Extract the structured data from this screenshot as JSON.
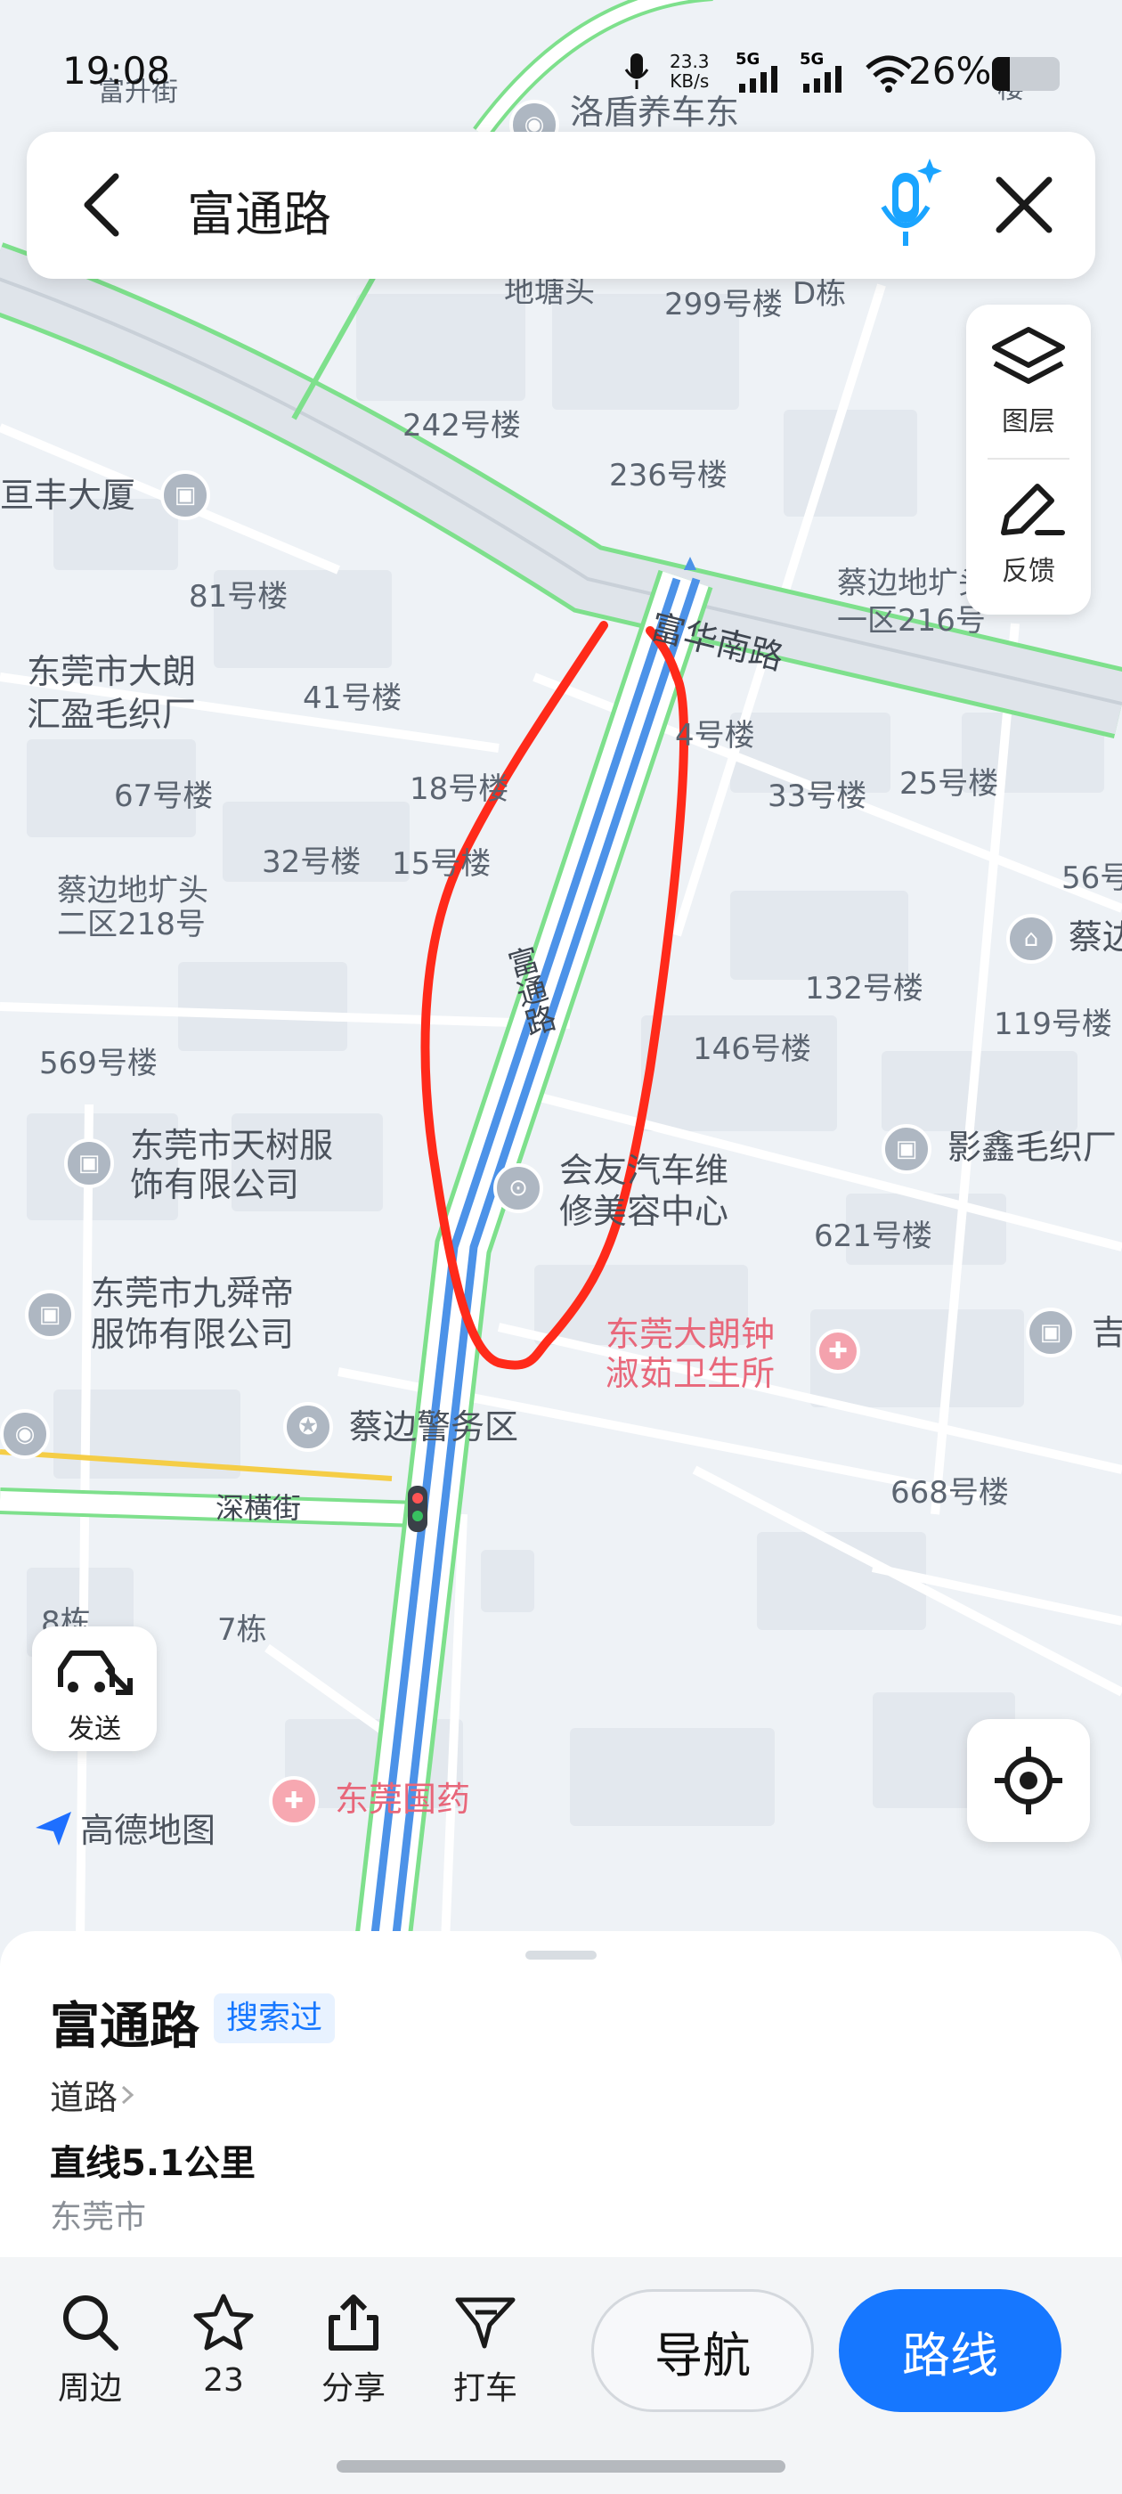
{
  "status_bar": {
    "time": "19:08",
    "net_speed_top": "23.3",
    "net_speed_unit": "KB/s",
    "sig1": "5G",
    "sig2": "5G",
    "battery": "26%"
  },
  "search": {
    "query": "富通路"
  },
  "map": {
    "labels": {
      "luodun": "洛盾养车东",
      "ditang": "地塘头",
      "b299": "299号楼",
      "dbuilding": "D栋",
      "b242": "242号楼",
      "b236": "236号楼",
      "hengfeng": "亘丰大厦",
      "b81": "81号楼",
      "caibian216": "蔡边地圹头一区216号",
      "fuhua": "富华南路",
      "dalang_line1": "东莞市大朗",
      "dalang_line2": "汇盈毛织厂",
      "b41": "41号楼",
      "b4": "4号楼",
      "b67": "67号楼",
      "b18": "18号楼",
      "b33": "33号楼",
      "b25": "25号楼",
      "b32": "32号楼",
      "b15": "15号楼",
      "b56": "56号",
      "caibian218_line1": "蔡边地圹头",
      "caibian218_line2": "二区218号",
      "futong": "富通路",
      "b132": "132号楼",
      "b119": "119号楼",
      "caibian_right": "蔡边",
      "b146": "146号楼",
      "b569": "569号楼",
      "tianshu_line1": "东莞市天树服",
      "tianshu_line2": "饰有限公司",
      "yingxin": "影鑫毛织厂",
      "huiyou_line1": "会友汽车维",
      "huiyou_line2": "修美容中心",
      "b621": "621号楼",
      "jiushun_line1": "东莞市九舜帝",
      "jiushun_line2": "服饰有限公司",
      "clinic_line1": "东莞大朗钟",
      "clinic_line2": "淑茹卫生所",
      "ji": "吉",
      "police": "蔡边警务区",
      "b668": "668号楼",
      "shenheng": "深横街",
      "dong8": "8栋",
      "dong7": "7栋",
      "guoyao": "东莞国药",
      "amap": "高德地图",
      "lou_top": "楼",
      "luodun_top": "富升街"
    },
    "layers_label": "图层",
    "feedback_label": "反馈",
    "send_label": "发送"
  },
  "place": {
    "name": "富通路",
    "tag": "搜索过",
    "category": "道路",
    "distance": "直线5.1公里",
    "city": "东莞市"
  },
  "actions": {
    "nearby": "周边",
    "favorite_count": "23",
    "share": "分享",
    "taxi": "打车",
    "navigate": "导航",
    "route": "路线"
  },
  "colors": {
    "accent": "#1677ff",
    "road_blue": "#4c92e8",
    "annotation_red": "#ff2a1a",
    "map_bg": "#eef2f6"
  }
}
